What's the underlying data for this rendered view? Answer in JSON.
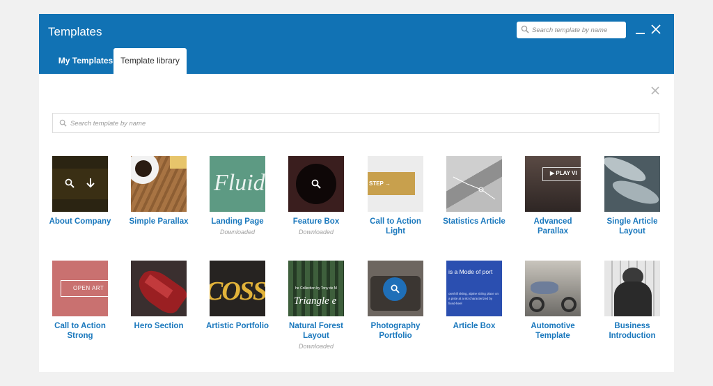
{
  "header": {
    "title": "Templates",
    "search_placeholder": "Search template by name",
    "tabs": [
      {
        "label": "My Templates",
        "active": false
      },
      {
        "label": "Template library",
        "active": true
      }
    ]
  },
  "main": {
    "search_placeholder": "Search template by name"
  },
  "thumb_texts": {
    "feature_box": "",
    "call_to_action_light": "STEP →",
    "advanced_parallax": "▶ PLAY VI",
    "call_to_action_strong": "OPEN ART",
    "landing_page": "Fluid",
    "natural_forest_caption": "he Collection by Tony de M",
    "natural_forest_script": "Triangle e",
    "article_box_title": "is a Mode of port",
    "article_box_body": "ownhill skiing, alpine skiing place on a piste at a ski characterized by fixed-heel",
    "artistic_portfolio": "COSS"
  },
  "templates": [
    {
      "name": "About Company",
      "status": ""
    },
    {
      "name": "Simple Parallax",
      "status": ""
    },
    {
      "name": "Landing Page",
      "status": "Downloaded"
    },
    {
      "name": "Feature Box",
      "status": "Downloaded"
    },
    {
      "name": "Call to Action Light",
      "status": ""
    },
    {
      "name": "Statistics Article",
      "status": ""
    },
    {
      "name": "Advanced Parallax",
      "status": ""
    },
    {
      "name": "Single Article Layout",
      "status": ""
    },
    {
      "name": "Call to Action Strong",
      "status": ""
    },
    {
      "name": "Hero Section",
      "status": ""
    },
    {
      "name": "Artistic Portfolio",
      "status": ""
    },
    {
      "name": "Natural Forest Layout",
      "status": "Downloaded"
    },
    {
      "name": "Photography Portfolio",
      "status": ""
    },
    {
      "name": "Article Box",
      "status": ""
    },
    {
      "name": "Automotive Template",
      "status": ""
    },
    {
      "name": "Business Introduction",
      "status": ""
    }
  ],
  "colors": {
    "header": "#1172b4",
    "link": "#1a78bd",
    "background": "#f1f1f1"
  }
}
